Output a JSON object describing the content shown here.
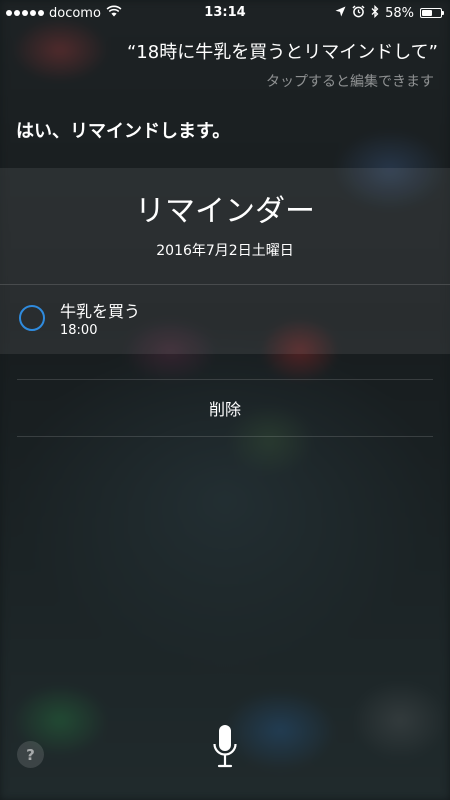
{
  "status_bar": {
    "carrier": "docomo",
    "time": "13:14",
    "battery_text": "58%",
    "battery_level": 0.58,
    "icons": [
      "signal-dots-icon",
      "wifi-icon",
      "location-arrow-icon",
      "alarm-icon",
      "bluetooth-icon",
      "battery-icon"
    ]
  },
  "siri": {
    "query": "“18時に牛乳を買うとリマインドして”",
    "tap_hint": "タップすると編集できます",
    "response": "はい、リマインドします。"
  },
  "reminder_card": {
    "title": "リマインダー",
    "date": "2016年7月2日土曜日",
    "task": {
      "title": "牛乳を買う",
      "time": "18:00",
      "completed": false
    }
  },
  "actions": {
    "delete_label": "削除"
  },
  "bottom": {
    "help_label": "?",
    "mic_icon": "microphone-icon"
  },
  "colors": {
    "accent": "#2f8bde",
    "text": "#ffffff"
  }
}
